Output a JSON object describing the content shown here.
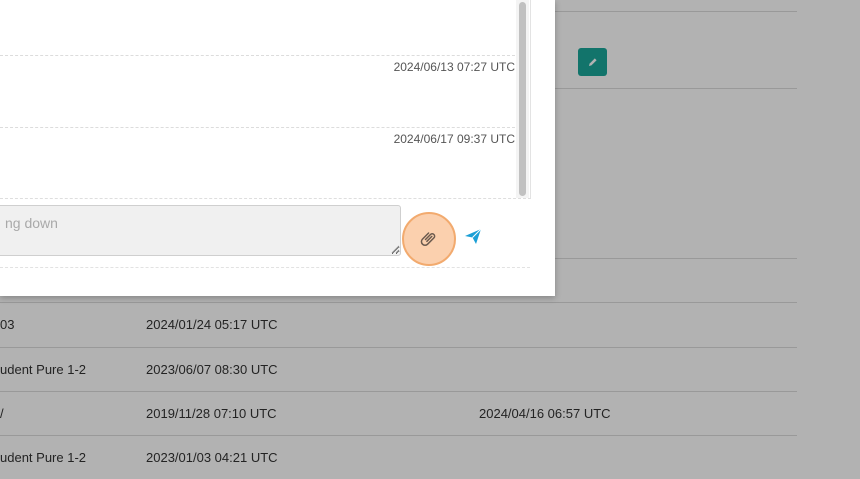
{
  "background_table": {
    "rows": [
      {
        "col1": "03",
        "col2": "2024/01/24 05:17 UTC",
        "col3": ""
      },
      {
        "col1": "udent Pure 1-2",
        "col2": "2023/06/07 08:30 UTC",
        "col3": ""
      },
      {
        "col1": "/",
        "col2": "2019/11/28 07:10 UTC",
        "col3": "2024/04/16 06:57 UTC"
      },
      {
        "col1": "udent Pure 1-2",
        "col2": "2023/01/03 04:21 UTC",
        "col3": ""
      }
    ]
  },
  "modal": {
    "messages": [
      {
        "timestamp": "2024/06/13 07:27 UTC"
      },
      {
        "timestamp": "2024/06/17 09:37 UTC"
      }
    ],
    "composer": {
      "placeholder": "ng down",
      "value": ""
    }
  },
  "icons": {
    "edit": "pencil-icon",
    "attach": "paperclip-icon",
    "send": "paper-plane-icon"
  },
  "colors": {
    "accent_teal": "#1aa79a",
    "send_blue": "#1a9fd6",
    "attach_highlight": "#fbd0ae"
  }
}
